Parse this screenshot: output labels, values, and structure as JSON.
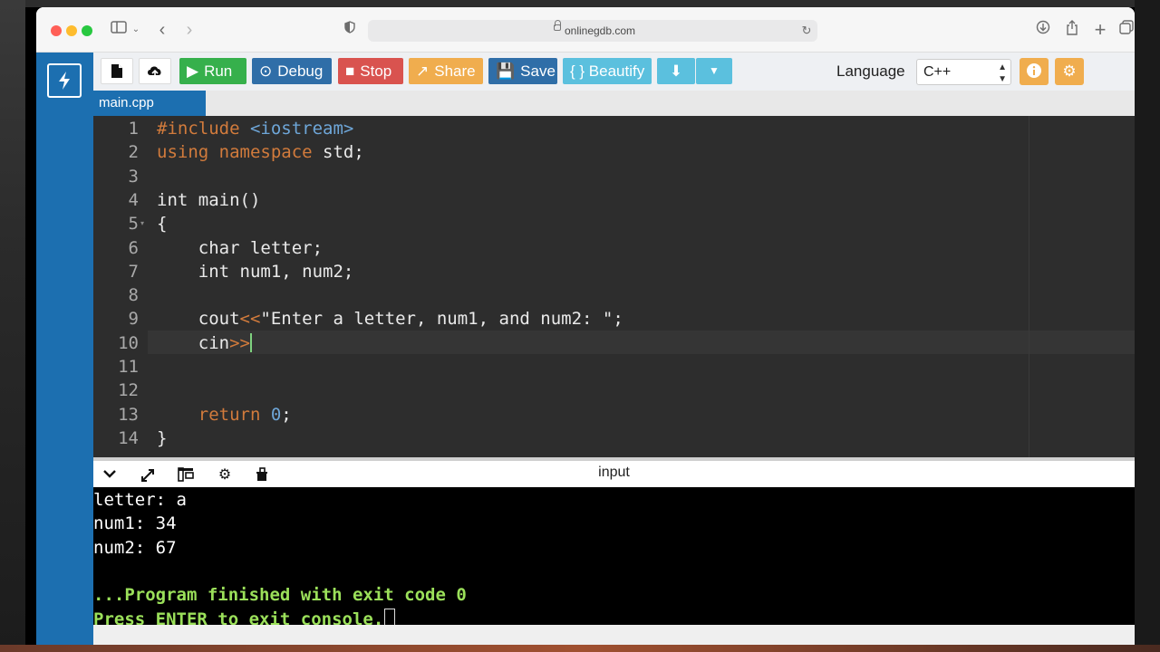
{
  "browser": {
    "url": "onlinegdb.com"
  },
  "toolbar": {
    "run_label": "Run",
    "debug_label": "Debug",
    "stop_label": "Stop",
    "share_label": "Share",
    "save_label": "Save",
    "beautify_label": "{ } Beautify",
    "language_label": "Language",
    "language_value": "C++",
    "colors": {
      "run": "#36b04c",
      "debug": "#2f6ea8",
      "stop": "#d9534f",
      "share": "#f0ad4e",
      "save": "#2f6ea8",
      "beautify": "#5bc0de",
      "download": "#5bc0de",
      "orange": "#f0ad4e"
    }
  },
  "file_tab": {
    "name": "main.cpp"
  },
  "editor": {
    "line_numbers": [
      "1",
      "2",
      "3",
      "4",
      "5",
      "6",
      "7",
      "8",
      "9",
      "10",
      "11",
      "12",
      "13",
      "14"
    ],
    "active_line": 10,
    "lines": {
      "l1_a": "#include ",
      "l1_b": "<iostream>",
      "l2_a": "using namespace",
      "l2_b": " std;",
      "l4": "int main()",
      "l5": "{",
      "l6": "    char letter;",
      "l7": "    int num1, num2;",
      "l9_a": "    cout",
      "l9_b": "<<",
      "l9_c": "\"Enter a letter, num1, and num2: \"",
      "l9_d": ";",
      "l10_a": "    cin",
      "l10_b": ">>",
      "l13_a": "    return ",
      "l13_b": "0",
      "l13_c": ";",
      "l14": "}"
    }
  },
  "console": {
    "title": "input",
    "lines": [
      "letter: a",
      "num1: 34",
      "num2: 67",
      ""
    ],
    "finished": "...Program finished with exit code 0",
    "press_enter": "Press ENTER to exit console."
  }
}
